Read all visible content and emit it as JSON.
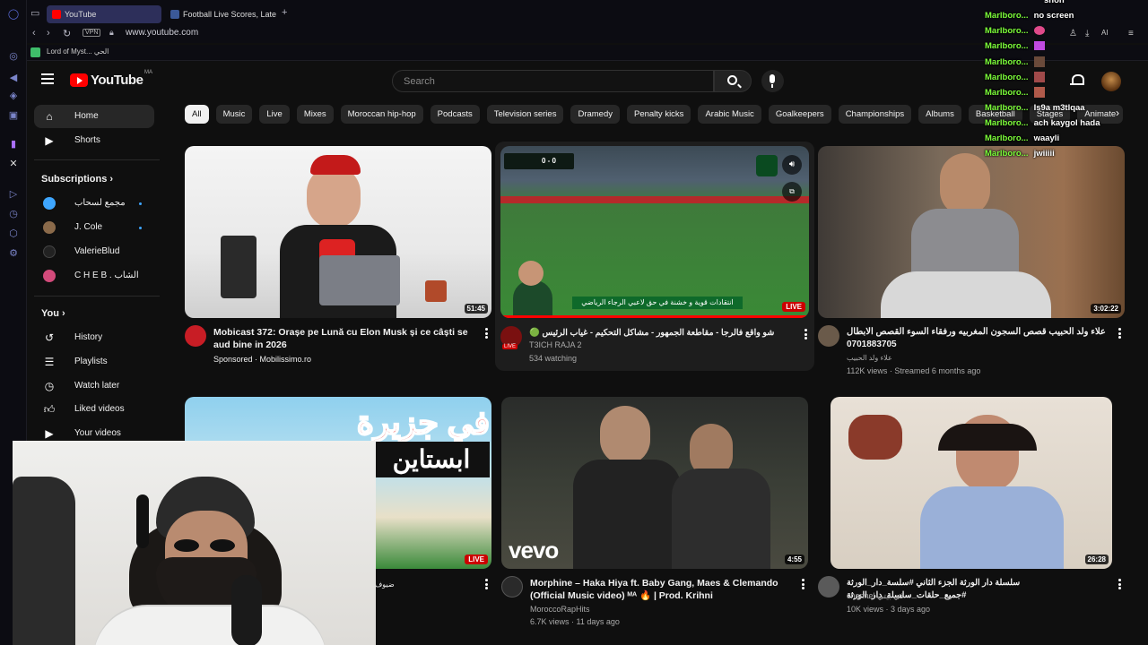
{
  "browser": {
    "tabs": [
      {
        "label": "YouTube",
        "active": true
      },
      {
        "label": "Football Live Scores, Late",
        "active": false
      }
    ],
    "vpn_label": "VPN",
    "url": "www.youtube.com",
    "bookmark": "Lord of Myst... الحي",
    "ai_label": "AI"
  },
  "header": {
    "logo_text": "YouTube",
    "country_code": "MA",
    "search_placeholder": "Search"
  },
  "guide": {
    "main": [
      {
        "label": "Home",
        "icon": "home-icon",
        "active": true
      },
      {
        "label": "Shorts",
        "icon": "shorts-icon",
        "active": false
      }
    ],
    "subscriptions_title": "Subscriptions",
    "subscriptions": [
      {
        "label": "مجمع لسحاب",
        "color": "#3ea6ff",
        "new": true
      },
      {
        "label": "J. Cole",
        "color": "#8a6a4a",
        "new": true
      },
      {
        "label": "ValerieBlud",
        "color": "#222222",
        "new": false
      },
      {
        "label": "C H E B . الشاب",
        "color": "#d24a7a",
        "new": false
      }
    ],
    "you_title": "You",
    "you": [
      {
        "label": "History",
        "icon": "history-icon"
      },
      {
        "label": "Playlists",
        "icon": "playlists-icon"
      },
      {
        "label": "Watch later",
        "icon": "watch-later-icon"
      },
      {
        "label": "Liked videos",
        "icon": "liked-icon"
      },
      {
        "label": "Your videos",
        "icon": "your-videos-icon"
      }
    ]
  },
  "chips": [
    "All",
    "Music",
    "Live",
    "Mixes",
    "Moroccan hip-hop",
    "Podcasts",
    "Television series",
    "Dramedy",
    "Penalty kicks",
    "Arabic Music",
    "Goalkeepers",
    "Championships",
    "Albums",
    "Basketball",
    "Stages",
    "Animate"
  ],
  "videos": [
    {
      "title": "Mobicast 372: Orașe pe Lună cu Elon Musk și ce câști se aud bine in 2026",
      "meta1": "Sponsored · Mobilissimo.ro",
      "meta2": "",
      "badge": "51:45"
    },
    {
      "title": "🟢 شو واقع فالرجا - مقاطعة الجمهور - مشاكل التحكيم - غياب الرئيس",
      "meta1": "T3ICH RAJA 2",
      "meta2": "534 watching",
      "badge": "LIVE",
      "overlay_text": "انتقادات قوية و خشنة في حق لاعبي الرجاء الرياضي",
      "score": "0 - 0",
      "avatar_badge": "LIVE"
    },
    {
      "title": "علاء ولد الحبيب قصص السجون المغربيه ورفقاء السوء القصص الابطال 0701883705",
      "meta1": "علاء ولد الحبيب",
      "meta2": "112K views · Streamed 6 months ago",
      "badge": "3:02:22"
    },
    {
      "title": "ضيوف",
      "meta1": "",
      "meta2": "",
      "badge": "LIVE",
      "overlay_text1": "في جزيرة",
      "overlay_text2": "ابستاين"
    },
    {
      "title": "Morphine – Haka Hiya ft. Baby Gang, Maes & Clemando (Official Music video) ᴹᴬ 🔥 | Prod. Krihni",
      "meta1": "MoroccoRapHits",
      "meta2": "6.7K views · 11 days ago",
      "badge": "4:55",
      "overlay_text": "vevo"
    },
    {
      "title": "سلسلة دار الورثة الجزء الثاني #سلسة_دار_الورثة #جميع_حلقات_سلسلة_دار_الورثة",
      "meta1": "channel في بيتي",
      "meta2": "10K views · 3 days ago",
      "badge": "26:28"
    }
  ],
  "chat": [
    {
      "user": "",
      "msg": "shon"
    },
    {
      "user": "Marlboro...",
      "msg": "no screen"
    },
    {
      "user": "Marlboro...",
      "msg": ""
    },
    {
      "user": "Marlboro...",
      "msg": ""
    },
    {
      "user": "Marlboro...",
      "msg": ""
    },
    {
      "user": "Marlboro...",
      "msg": ""
    },
    {
      "user": "Marlboro...",
      "msg": ""
    },
    {
      "user": "Marlboro...",
      "msg": "Is9a m3tlqaa"
    },
    {
      "user": "Marlboro...",
      "msg": "ach kaygol hada"
    },
    {
      "user": "Marlboro...",
      "msg": "waayli"
    },
    {
      "user": "Marlboro...",
      "msg": "jwiiiii"
    }
  ]
}
